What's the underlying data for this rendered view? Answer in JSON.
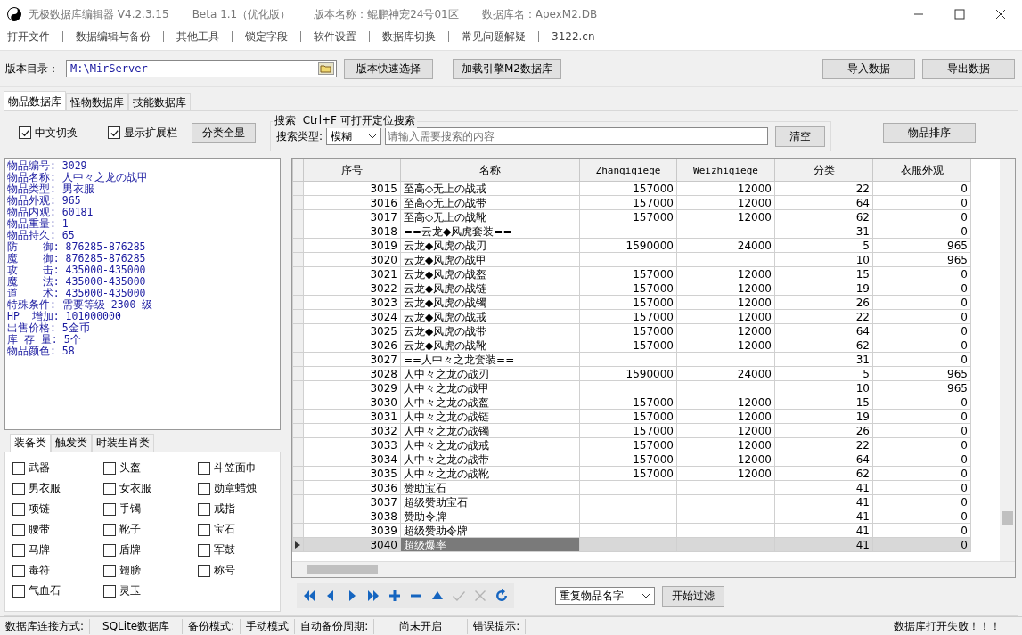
{
  "window": {
    "app": "无极数据库编辑器 V4.2.3.15",
    "edition": "Beta 1.1（优化版）",
    "version_name": "版本名称：鲲鹏神宠24号01区",
    "db_name": "数据库名：ApexM2.DB"
  },
  "menu": [
    "打开文件",
    "数据编辑与备份",
    "其他工具",
    "锁定字段",
    "软件设置",
    "数据库切换",
    "常见问题解疑",
    "3122.cn"
  ],
  "toolbar": {
    "dir_label": "版本目录：",
    "dir_value": "M:\\MirServer",
    "buttons": [
      "版本快速选择",
      "加载引擎M2数据库"
    ],
    "right_buttons": [
      "导入数据",
      "导出数据"
    ]
  },
  "tabs": [
    {
      "label": "物品数据库",
      "selected": true
    },
    {
      "label": "怪物数据库",
      "selected": false
    },
    {
      "label": "技能数据库",
      "selected": false
    }
  ],
  "options": {
    "checkboxes": [
      {
        "label": "中文切换",
        "checked": true
      },
      {
        "label": "显示扩展栏",
        "checked": true
      }
    ],
    "show_all_button": "分类全显",
    "search_title": "搜索  Ctrl+F 可打开定位搜索",
    "search_type_label": "搜索类型:",
    "search_type": "模糊",
    "search_placeholder": "请输入需要搜索的内容",
    "clear_button": "清空",
    "sort_button": "物品排序"
  },
  "info": [
    "物品编号: 3029",
    "物品名称: 人中々之龙の战甲",
    "物品类型: 男衣服",
    "物品外观: 965",
    "物品内观: 60181",
    "物品重量: 1",
    "物品持久: 65",
    "防    御: 876285-876285",
    "魔    御: 876285-876285",
    "攻    击: 435000-435000",
    "魔    法: 435000-435000",
    "道    术: 435000-435000",
    "特殊条件: 需要等级 2300 级",
    "HP  增加: 101000000",
    "出售价格: 5金币",
    "库 存 量: 5个",
    "物品颜色: 58"
  ],
  "category_tabs": [
    {
      "label": "装备类",
      "selected": true
    },
    {
      "label": "触发类",
      "selected": false
    },
    {
      "label": "时装生肖类",
      "selected": false
    }
  ],
  "categories": [
    {
      "label": "武器",
      "checked": false
    },
    {
      "label": "头盔",
      "checked": false
    },
    {
      "label": "斗笠面巾",
      "checked": false
    },
    {
      "label": "男衣服",
      "checked": false
    },
    {
      "label": "女衣服",
      "checked": false
    },
    {
      "label": "勋章蜡烛",
      "checked": false
    },
    {
      "label": "项链",
      "checked": false
    },
    {
      "label": "手镯",
      "checked": false
    },
    {
      "label": "戒指",
      "checked": false
    },
    {
      "label": "腰带",
      "checked": false
    },
    {
      "label": "靴子",
      "checked": false
    },
    {
      "label": "宝石",
      "checked": false
    },
    {
      "label": "马牌",
      "checked": false
    },
    {
      "label": "盾牌",
      "checked": false
    },
    {
      "label": "军鼓",
      "checked": false
    },
    {
      "label": "毒符",
      "checked": false
    },
    {
      "label": "翅膀",
      "checked": false
    },
    {
      "label": "称号",
      "checked": false
    },
    {
      "label": "气血石",
      "checked": false
    },
    {
      "label": "灵玉",
      "checked": false
    }
  ],
  "table": {
    "columns": [
      "序号",
      "名称",
      "Zhanqiqiege",
      "Weizhiqiege",
      "分类",
      "衣服外观"
    ],
    "rows": [
      {
        "cells": [
          "3015",
          "至高◇无上の战戒",
          "157000",
          "12000",
          "22",
          "0"
        ],
        "selected": false
      },
      {
        "cells": [
          "3016",
          "至高◇无上の战带",
          "157000",
          "12000",
          "64",
          "0"
        ],
        "selected": false
      },
      {
        "cells": [
          "3017",
          "至高◇无上の战靴",
          "157000",
          "12000",
          "62",
          "0"
        ],
        "selected": false
      },
      {
        "cells": [
          "3018",
          "==云龙◆风虎套装==",
          "",
          "",
          "31",
          "0"
        ],
        "selected": false
      },
      {
        "cells": [
          "3019",
          "云龙◆风虎の战刃",
          "1590000",
          "24000",
          "5",
          "965"
        ],
        "selected": false
      },
      {
        "cells": [
          "3020",
          "云龙◆风虎の战甲",
          "",
          "",
          "10",
          "965"
        ],
        "selected": false
      },
      {
        "cells": [
          "3021",
          "云龙◆风虎の战盔",
          "157000",
          "12000",
          "15",
          "0"
        ],
        "selected": false
      },
      {
        "cells": [
          "3022",
          "云龙◆风虎の战链",
          "157000",
          "12000",
          "19",
          "0"
        ],
        "selected": false
      },
      {
        "cells": [
          "3023",
          "云龙◆风虎の战镯",
          "157000",
          "12000",
          "26",
          "0"
        ],
        "selected": false
      },
      {
        "cells": [
          "3024",
          "云龙◆风虎の战戒",
          "157000",
          "12000",
          "22",
          "0"
        ],
        "selected": false
      },
      {
        "cells": [
          "3025",
          "云龙◆风虎の战带",
          "157000",
          "12000",
          "64",
          "0"
        ],
        "selected": false
      },
      {
        "cells": [
          "3026",
          "云龙◆风虎の战靴",
          "157000",
          "12000",
          "62",
          "0"
        ],
        "selected": false
      },
      {
        "cells": [
          "3027",
          "==人中々之龙套装==",
          "",
          "",
          "31",
          "0"
        ],
        "selected": false
      },
      {
        "cells": [
          "3028",
          "人中々之龙の战刃",
          "1590000",
          "24000",
          "5",
          "965"
        ],
        "selected": false
      },
      {
        "cells": [
          "3029",
          "人中々之龙の战甲",
          "",
          "",
          "10",
          "965"
        ],
        "selected": false
      },
      {
        "cells": [
          "3030",
          "人中々之龙の战盔",
          "157000",
          "12000",
          "15",
          "0"
        ],
        "selected": false
      },
      {
        "cells": [
          "3031",
          "人中々之龙の战链",
          "157000",
          "12000",
          "19",
          "0"
        ],
        "selected": false
      },
      {
        "cells": [
          "3032",
          "人中々之龙の战镯",
          "157000",
          "12000",
          "26",
          "0"
        ],
        "selected": false
      },
      {
        "cells": [
          "3033",
          "人中々之龙の战戒",
          "157000",
          "12000",
          "22",
          "0"
        ],
        "selected": false
      },
      {
        "cells": [
          "3034",
          "人中々之龙の战带",
          "157000",
          "12000",
          "64",
          "0"
        ],
        "selected": false
      },
      {
        "cells": [
          "3035",
          "人中々之龙の战靴",
          "157000",
          "12000",
          "62",
          "0"
        ],
        "selected": false
      },
      {
        "cells": [
          "3036",
          "赞助宝石",
          "",
          "",
          "41",
          "0"
        ],
        "selected": false
      },
      {
        "cells": [
          "3037",
          "超级赞助宝石",
          "",
          "",
          "41",
          "0"
        ],
        "selected": false
      },
      {
        "cells": [
          "3038",
          "赞助令牌",
          "",
          "",
          "41",
          "0"
        ],
        "selected": false
      },
      {
        "cells": [
          "3039",
          "超级赞助令牌",
          "",
          "",
          "41",
          "0"
        ],
        "selected": false
      },
      {
        "cells": [
          "3040",
          "超级爆率",
          "",
          "",
          "41",
          "0"
        ],
        "selected": true
      }
    ]
  },
  "navigator": [
    {
      "kind": "first",
      "disabled": false
    },
    {
      "kind": "prev",
      "disabled": false
    },
    {
      "kind": "next",
      "disabled": false
    },
    {
      "kind": "last",
      "disabled": false
    },
    {
      "kind": "add",
      "disabled": false
    },
    {
      "kind": "delete",
      "disabled": false
    },
    {
      "kind": "edit",
      "disabled": false
    },
    {
      "kind": "post",
      "disabled": true
    },
    {
      "kind": "cancel",
      "disabled": true
    },
    {
      "kind": "refresh",
      "disabled": false
    }
  ],
  "filter": {
    "value": "重复物品名字",
    "button": "开始过滤"
  },
  "status_bar": [
    "数据库连接方式:",
    "SQLite数据库",
    "备份模式:",
    "手动模式",
    "自动备份周期:",
    "尚未开启",
    "错误提示:",
    "数据库打开失败！！！"
  ]
}
